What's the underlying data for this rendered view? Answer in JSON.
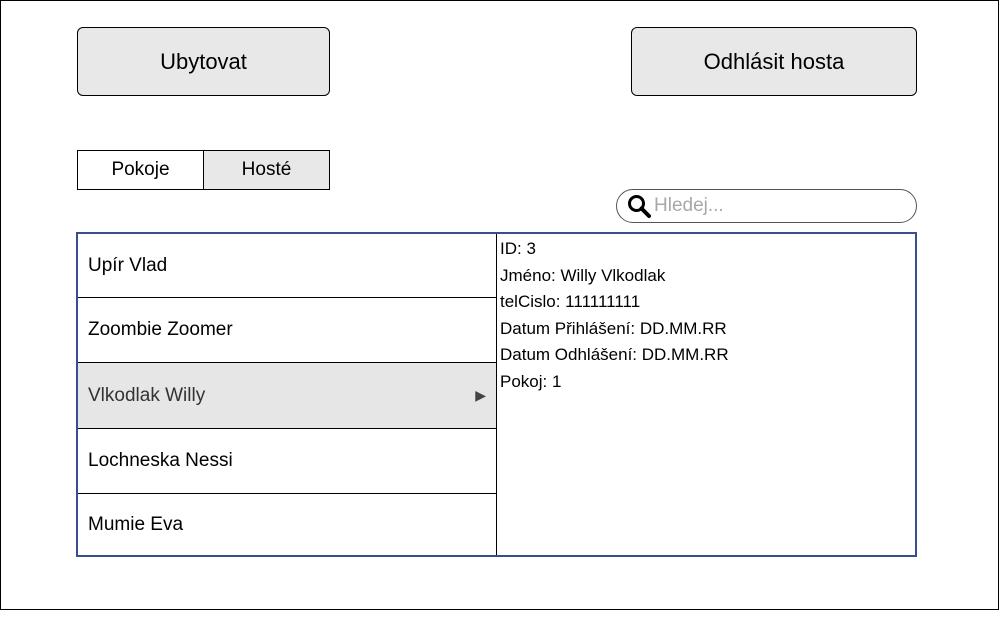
{
  "buttons": {
    "ubytovat": "Ubytovat",
    "odhlasit": "Odhlásit hosta"
  },
  "tabs": [
    {
      "label": "Pokoje",
      "active": false
    },
    {
      "label": "Hosté",
      "active": true
    }
  ],
  "search": {
    "placeholder": "Hledej...",
    "icon": "search-icon"
  },
  "guest_list": {
    "items": [
      {
        "label": "Upír Vlad"
      },
      {
        "label": "Zoombie Zoomer"
      },
      {
        "label": "Vlkodlak Willy",
        "selected": true
      },
      {
        "label": "Lochneska Nessi"
      },
      {
        "label": "Mumie Eva"
      }
    ],
    "arrow_glyph": "▶"
  },
  "detail": {
    "lines": [
      "ID: 3",
      "Jméno: Willy Vlkodlak",
      "telCislo: 111111111",
      "Datum Přihlášení: DD.MM.RR",
      "Datum Odhlášení: DD.MM.RR",
      "Pokoj: 1"
    ]
  },
  "colors": {
    "panel_border": "#3a4d8f",
    "button_fill": "#e8e8e8",
    "selected_row": "#e6e6e6"
  }
}
